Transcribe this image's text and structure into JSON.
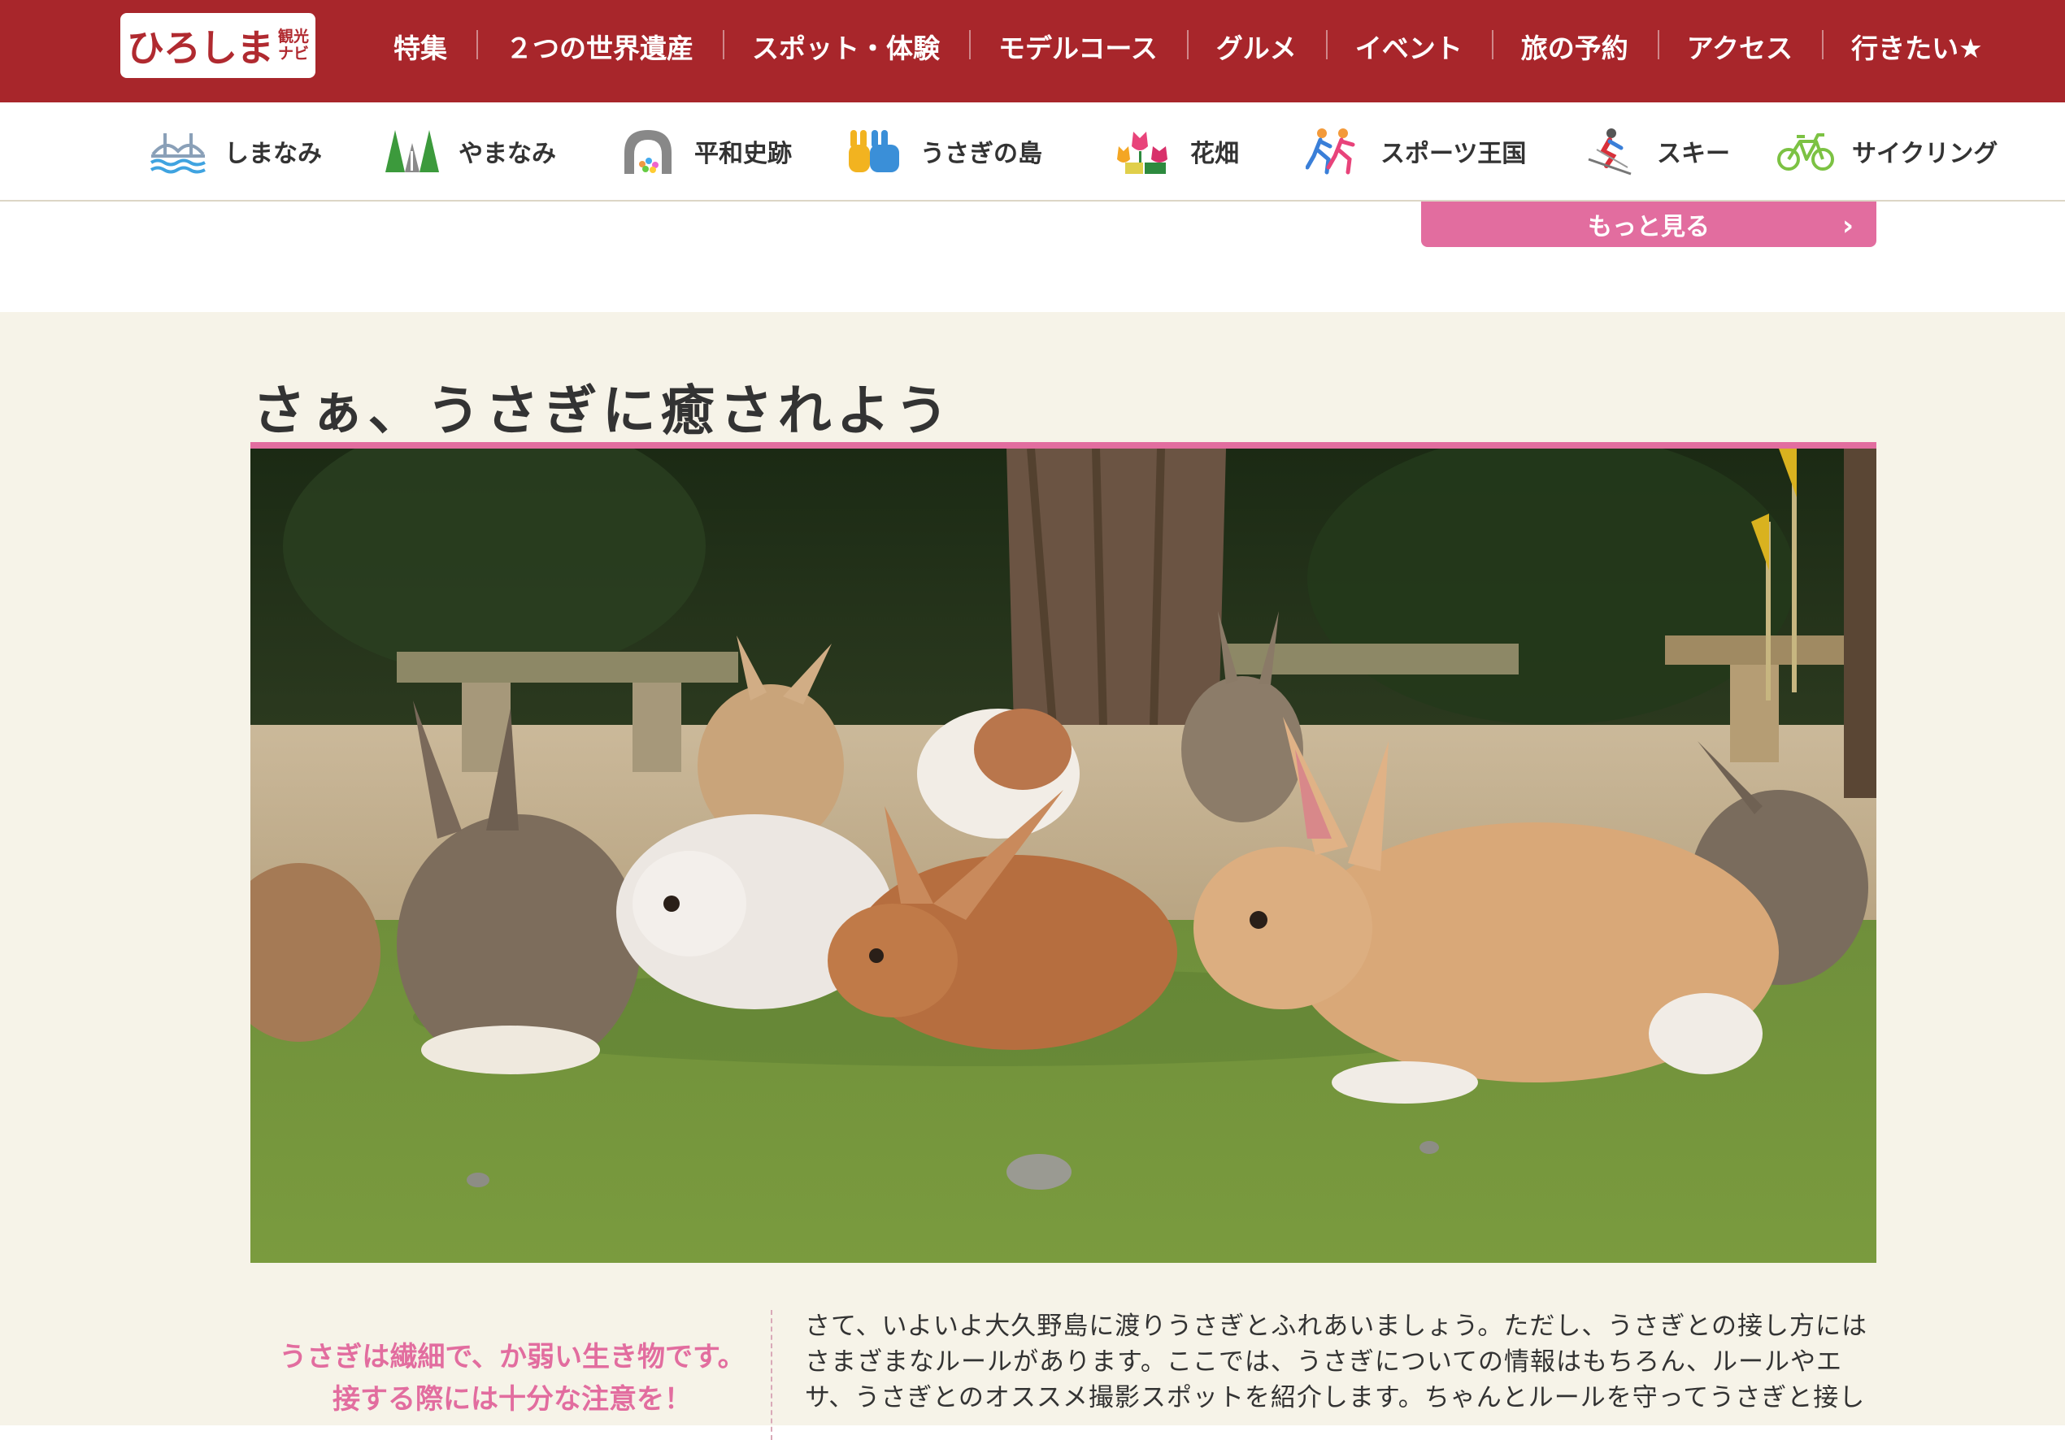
{
  "logo": {
    "main": "ひろしま",
    "sub_line1": "観光",
    "sub_line2": "ナビ"
  },
  "top_nav": [
    "特集",
    "２つの世界遺産",
    "スポット・体験",
    "モデルコース",
    "グルメ",
    "イベント",
    "旅の予約",
    "アクセス",
    "行きたい★"
  ],
  "categories": [
    {
      "label": "しまなみ",
      "icon": "bridge-icon"
    },
    {
      "label": "やまなみ",
      "icon": "trees-icon"
    },
    {
      "label": "平和史跡",
      "icon": "dome-icon"
    },
    {
      "label": "うさぎの島",
      "icon": "rabbits-icon"
    },
    {
      "label": "花畑",
      "icon": "flowers-icon"
    },
    {
      "label": "スポーツ王国",
      "icon": "runners-icon"
    },
    {
      "label": "スキー",
      "icon": "skier-icon"
    },
    {
      "label": "サイクリング",
      "icon": "bicycle-icon"
    }
  ],
  "more_button": {
    "label": "もっと見る"
  },
  "section": {
    "title": "さぁ、うさぎに癒されよう",
    "lead": "うさぎは繊細で、か弱い生き物です。接する際には十分な注意を！",
    "body": "さて、いよいよ大久野島に渡りうさぎとふれあいましょう。ただし、うさぎとの接し方にはさまざまなルールがあります。ここでは、うさぎについての情報はもちろん、ルールやエサ、うさぎとのオススメ撮影スポットを紹介します。ちゃんとルールを守ってうさぎと接し"
  },
  "colors": {
    "header_red": "#a8262b",
    "accent_pink": "#e26d9f",
    "beige": "#f6f3e8"
  }
}
